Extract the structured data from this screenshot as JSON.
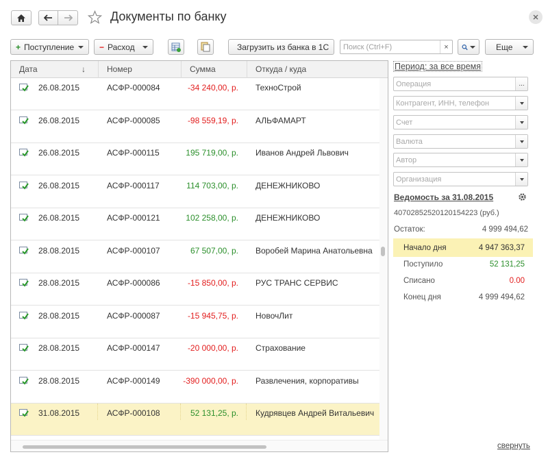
{
  "window": {
    "title": "Документы по банку"
  },
  "toolbar": {
    "receipt_label": "Поступление",
    "expense_label": "Расход",
    "load_label": "Загрузить из банка в 1С",
    "search_placeholder": "Поиск (Ctrl+F)",
    "search_clear": "×",
    "more_label": "Еще"
  },
  "table": {
    "headers": [
      "Дата",
      "Номер",
      "Сумма",
      "Откуда / куда"
    ],
    "sort_indicator": "↓",
    "rows": [
      {
        "date": "26.08.2015",
        "number": "АСФР-000084",
        "amount": "-34 240,00, р.",
        "counterparty": "ТехноСтрой",
        "sign": "neg"
      },
      {
        "date": "26.08.2015",
        "number": "АСФР-000085",
        "amount": "-98 559,19, р.",
        "counterparty": "АЛЬФАМАРТ",
        "sign": "neg"
      },
      {
        "date": "26.08.2015",
        "number": "АСФР-000115",
        "amount": "195 719,00, р.",
        "counterparty": "Иванов Андрей Львович",
        "sign": "pos"
      },
      {
        "date": "26.08.2015",
        "number": "АСФР-000117",
        "amount": "114 703,00, р.",
        "counterparty": "ДЕНЕЖНИКОВО",
        "sign": "pos"
      },
      {
        "date": "26.08.2015",
        "number": "АСФР-000121",
        "amount": "102 258,00, р.",
        "counterparty": "ДЕНЕЖНИКОВО",
        "sign": "pos"
      },
      {
        "date": "28.08.2015",
        "number": "АСФР-000107",
        "amount": "67 507,00, р.",
        "counterparty": "Воробей Марина Анатольевна",
        "sign": "pos"
      },
      {
        "date": "28.08.2015",
        "number": "АСФР-000086",
        "amount": "-15 850,00, р.",
        "counterparty": "РУС ТРАНС СЕРВИС",
        "sign": "neg"
      },
      {
        "date": "28.08.2015",
        "number": "АСФР-000087",
        "amount": "-15 945,75, р.",
        "counterparty": "НовочЛит",
        "sign": "neg"
      },
      {
        "date": "28.08.2015",
        "number": "АСФР-000147",
        "amount": "-20 000,00, р.",
        "counterparty": "Страхование",
        "sign": "neg"
      },
      {
        "date": "28.08.2015",
        "number": "АСФР-000149",
        "amount": "-390 000,00, р.",
        "counterparty": "Развлечения, корпоративы",
        "sign": "neg"
      },
      {
        "date": "31.08.2015",
        "number": "АСФР-000108",
        "amount": "52 131,25, р.",
        "counterparty": "Кудрявцев Андрей Витальевич",
        "sign": "pos",
        "selected": true
      }
    ]
  },
  "filters": {
    "period": "Период: за все время",
    "operation": "Операция",
    "operation_btn": "...",
    "counterparty": "Контрагент, ИНН, телефон",
    "account": "Счет",
    "currency": "Валюта",
    "author": "Автор",
    "organization": "Организация"
  },
  "statement": {
    "title": "Ведомость за 31.08.2015",
    "account": "40702852520120154223 (руб.)",
    "balance_label": "Остаток:",
    "balance_value": "4 999 494,62",
    "start_label": "Начало дня",
    "start_value": "4 947 363,37",
    "in_label": "Поступило",
    "in_value": "52 131,25",
    "out_label": "Списано",
    "out_value": "0.00",
    "end_label": "Конец дня",
    "end_value": "4 999 494,62"
  },
  "footer": {
    "collapse": "свернуть"
  },
  "colors": {
    "negative": "#e21d1d",
    "positive": "#2b8f2b",
    "selected_row": "#fbf3c6",
    "begin_day": "#fbf2b5"
  }
}
